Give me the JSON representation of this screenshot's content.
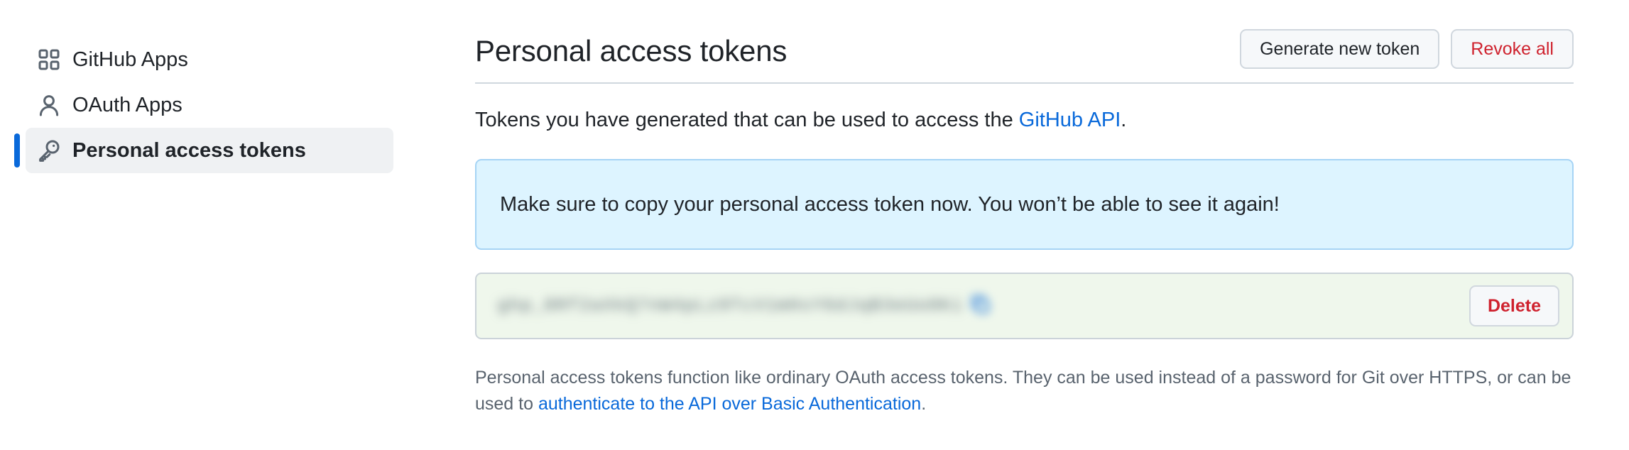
{
  "sidebar": {
    "items": [
      {
        "label": "GitHub Apps",
        "icon": "grid-apps-icon"
      },
      {
        "label": "OAuth Apps",
        "icon": "person-icon"
      },
      {
        "label": "Personal access tokens",
        "icon": "key-icon",
        "active": true
      }
    ]
  },
  "main": {
    "title": "Personal access tokens",
    "actions": {
      "generate_label": "Generate new token",
      "revoke_label": "Revoke all"
    },
    "description": {
      "prefix": "Tokens you have generated that can be used to access the ",
      "link": "GitHub API",
      "suffix": "."
    },
    "flash": {
      "message": "Make sure to copy your personal access token now. You won’t be able to see it again!"
    },
    "token": {
      "delete_label": "Delete",
      "icon": "copy-icon"
    },
    "note": {
      "text": "Personal access tokens function like ordinary OAuth access tokens. They can be used instead of a password for Git over HTTPS, or can be used to ",
      "link": "authenticate to the API over Basic Authentication",
      "suffix": "."
    }
  },
  "colors": {
    "accent": "#0969da",
    "danger": "#cf222e",
    "flash_bg": "#ddf4ff",
    "token_bg": "#eff7ec"
  }
}
